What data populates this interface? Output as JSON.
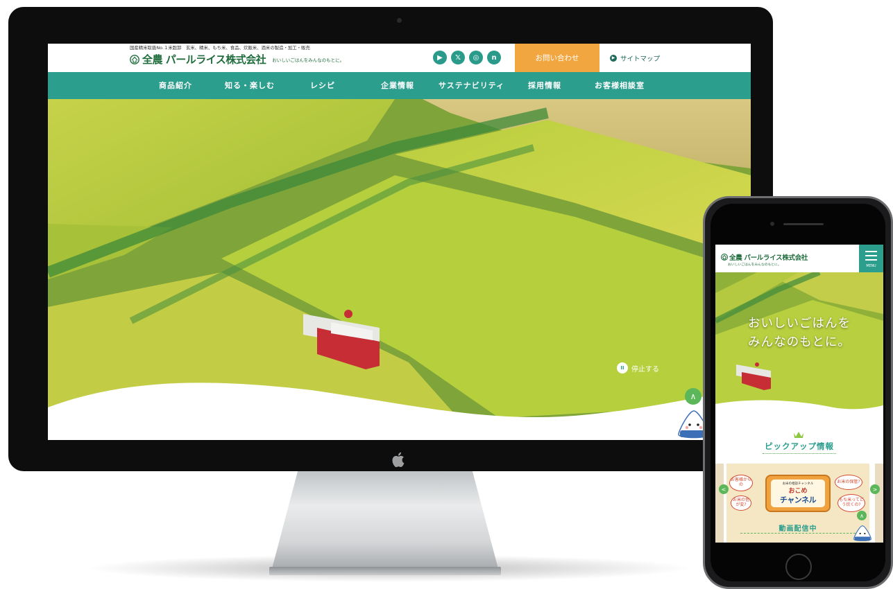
{
  "desktop": {
    "tagline": "国産精米取扱No.１米穀卸　玄米、精米、もち米、食品、炊飯米、酒米の製造・加工・販売",
    "logo_text": "全農 パールライス株式会社",
    "logo_sub": "おいしいごはんをみんなのもとに。",
    "social": [
      "youtube-icon",
      "x-icon",
      "instagram-icon",
      "note-icon"
    ],
    "social_glyphs": [
      "▶",
      "𝕏",
      "◎",
      "n"
    ],
    "contact_label": "お問い合わせ",
    "sitemap_label": "サイトマップ",
    "nav": [
      "商品紹介",
      "知る・楽しむ",
      "レシピ",
      "企業情報",
      "サステナビリティ",
      "採用情報",
      "お客様相談室"
    ],
    "pause_label": "停止する",
    "to_top_glyph": "∧"
  },
  "mobile": {
    "logo_text": "全農 パールライス株式会社",
    "logo_sub": "おいしいごはんをみんなのもとに。",
    "menu_label": "MENU",
    "hero_copy_line1": "おいしいごはんを",
    "hero_copy_line2": "みんなのもとに。",
    "pickup_title": "ピックアップ情報",
    "banner": {
      "channel_small": "お米の相談チャンネル",
      "channel_top": "おこめ",
      "channel_name": "チャンネル",
      "bubble_1": "お客様からの",
      "bubble_2": "お米の保管?",
      "bubble_3": "お米の色が変?",
      "bubble_4": "もち米ってどう炊くの?",
      "status": "動画配信中"
    },
    "prev_glyph": "<",
    "next_glyph": ">",
    "to_top_glyph": "∧"
  },
  "colors": {
    "teal": "#2b9e8d",
    "orange": "#f2a640",
    "green_logo": "#1f6d3c",
    "accent_green": "#5bb75a"
  }
}
